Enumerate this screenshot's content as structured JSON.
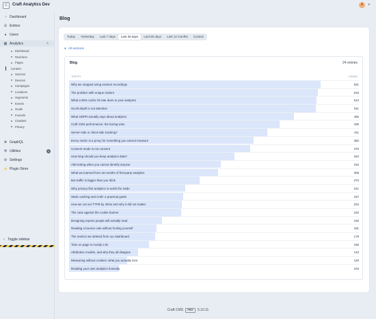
{
  "app": {
    "site_icon": "C",
    "site_name": "Craft Analytics Dev",
    "avatar_initial": "A"
  },
  "sidebar": {
    "items": [
      {
        "label": "Dashboard",
        "icon": "gauge-icon"
      },
      {
        "label": "Entries",
        "icon": "entries-icon"
      },
      {
        "label": "Users",
        "icon": "users-icon"
      },
      {
        "label": "Analytics",
        "icon": "analytics-icon"
      },
      {
        "label": "GraphQL",
        "icon": "graphql-icon"
      },
      {
        "label": "Utilities",
        "icon": "wrench-icon",
        "badge": "1"
      },
      {
        "label": "Settings",
        "icon": "gear-icon"
      },
      {
        "label": "Plugin Store",
        "icon": "plug-icon"
      }
    ],
    "analytics_subitems": [
      "Dashboard",
      "Real-time",
      "Pages",
      "Content",
      "Sources",
      "Devices",
      "Campaigns",
      "Locations",
      "Segments",
      "Events",
      "Goals",
      "Funnels",
      "Crawlers",
      "Privacy"
    ],
    "toggle_label": "Toggle sidebar"
  },
  "main": {
    "title": "Blog",
    "ranges": [
      "Today",
      "Yesterday",
      "Last 7 days",
      "Last 30 days",
      "Last 90 days",
      "Last 12 months",
      "Custom"
    ],
    "selected_range": "Last 30 days",
    "back_link": "All sections",
    "card": {
      "title": "Blog",
      "count": "24 entries",
      "col_entry": "ENTRY",
      "col_views": "VIEWS",
      "accent_color": "#dbe6fb",
      "rows": [
        {
          "entry": "Why we stopped using session recordings",
          "views": 521
        },
        {
          "entry": "The problem with unique visitors",
          "views": 515
        },
        {
          "entry": "What a 90% cache hit rate does to your analytics",
          "views": 513
        },
        {
          "entry": "Scroll depth is not attention",
          "views": 511
        },
        {
          "entry": "What GDPR actually says about analytics",
          "views": 466
        },
        {
          "entry": "Craft CMS performance: the boring wins",
          "views": 436
        },
        {
          "entry": "Server-side or client-side tracking?",
          "views": 411
        },
        {
          "entry": "Every metric is a proxy for something you cannot measure",
          "views": 382
        },
        {
          "entry": "Consent mode is not consent",
          "views": 375
        },
        {
          "entry": "How long should you keep analytics data?",
          "views": 343
        },
        {
          "entry": "A/B testing when you cannot identify anyone",
          "views": 315
        },
        {
          "entry": "What we learned from 18 months of first-party analytics",
          "views": 308
        },
        {
          "entry": "Bot traffic is bigger than you think",
          "views": 270
        },
        {
          "entry": "Why privacy-first analytics is worth the trade",
          "views": 241
        },
        {
          "entry": "Static caching and Craft: a practical guide",
          "views": 237
        },
        {
          "entry": "How we cut our TTFB by 40ms and why it did not matter",
          "views": 234
        },
        {
          "entry": "The case against the cookie banner",
          "views": 232
        },
        {
          "entry": "Designing reports people will actually read",
          "views": 192
        },
        {
          "entry": "Reading a bounce rate without fooling yourself",
          "views": 181
        },
        {
          "entry": "The metrics we deleted from our dashboard",
          "views": 179
        },
        {
          "entry": "Time on page is mostly a lie",
          "views": 166
        },
        {
          "entry": "Attribution models, and why they all disagree",
          "views": 143
        },
        {
          "entry": "Measuring without cookies: what you actually lose",
          "views": 120
        },
        {
          "entry": "Reading your own analytics honestly",
          "views": 103
        }
      ]
    }
  },
  "footer": {
    "product": "Craft CMS",
    "edition": "PRO",
    "version": "5.10.11"
  }
}
